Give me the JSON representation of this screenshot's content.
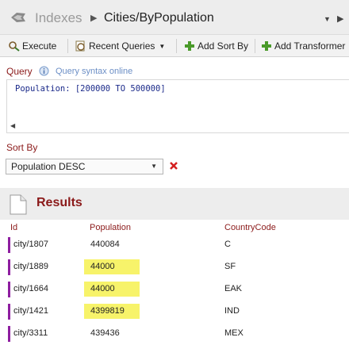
{
  "breadcrumb": {
    "root": "Indexes",
    "current": "Cities/ByPopulation"
  },
  "toolbar": {
    "execute": "Execute",
    "recent_queries": "Recent Queries",
    "add_sort_by": "Add Sort By",
    "add_transformer": "Add Transformer"
  },
  "query": {
    "label": "Query",
    "syntax_link": "Query syntax online",
    "text": "Population: [200000 TO 500000]"
  },
  "sort": {
    "label": "Sort By",
    "selected": "Population DESC"
  },
  "results": {
    "title": "Results",
    "columns": [
      "Id",
      "Population",
      "CountryCode"
    ],
    "rows": [
      {
        "id": "city/1807",
        "population": "440084",
        "country": "C",
        "highlight": false
      },
      {
        "id": "city/1889",
        "population": "44000",
        "country": "SF",
        "highlight": true
      },
      {
        "id": "city/1664",
        "population": "44000",
        "country": "EAK",
        "highlight": true
      },
      {
        "id": "city/1421",
        "population": "4399819",
        "country": "IND",
        "highlight": true
      },
      {
        "id": "city/3311",
        "population": "439436",
        "country": "MEX",
        "highlight": false
      }
    ]
  },
  "colors": {
    "accent": "#8b1a1a",
    "highlight": "#f7f36a",
    "row_marker": "#8e1ea0",
    "link": "#6c8fc6"
  },
  "icons": {
    "logo": "raven-logo-icon",
    "execute": "execute-icon",
    "recent_queries": "recent-queries-icon",
    "add": "green-plus-icon",
    "info": "info-icon",
    "remove": "red-x-icon",
    "results": "document-icon"
  }
}
